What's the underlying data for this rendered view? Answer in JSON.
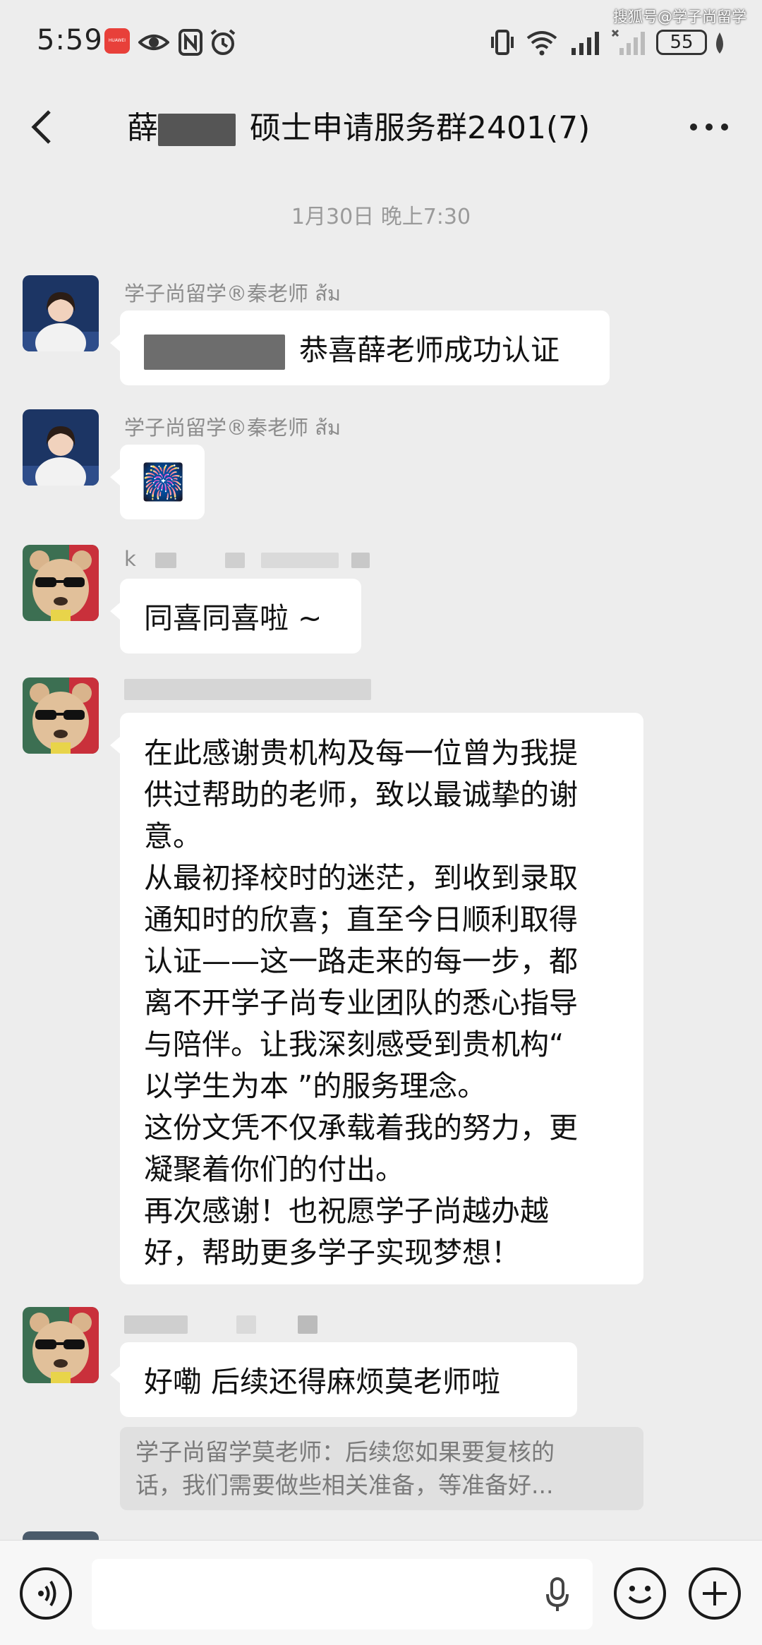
{
  "status_bar": {
    "time": "5:59",
    "brand_tag": "HUAWEI",
    "battery": "55",
    "watermark": "搜狐号@学子尚留学"
  },
  "nav": {
    "title_prefix": "薛",
    "title_suffix": "硕士申请服务群2401(7)"
  },
  "timestamp": "1月30日 晚上7:30",
  "messages": [
    {
      "sender": "学子尚留学®秦老师 ส้ม",
      "text_prefix": "",
      "text": "恭喜薛老师成功认证"
    },
    {
      "sender": "学子尚留学®秦老师 ส้ม",
      "emoji": "🎆"
    },
    {
      "sender": "k",
      "text": "同喜同喜啦 ~"
    },
    {
      "lines": [
        "在此感谢贵机构及每一位曾为我提",
        "供过帮助的老师，致以最诚挚的谢",
        "意。",
        "从最初择校时的迷茫，到收到录取",
        "通知时的欣喜；直至今日顺利取得",
        "认证——这一路走来的每一步，都",
        "离不开学子尚专业团队的悉心指导",
        "与陪伴。让我深刻感受到贵机构“",
        "以学生为本 ”的服务理念。",
        "这份文凭不仅承载着我的努力，更",
        "凝聚着你们的付出。",
        "再次感谢！也祝愿学子尚越办越",
        "好，帮助更多学子实现梦想！"
      ]
    },
    {
      "text": "好嘞  后续还得麻烦莫老师啦",
      "quote_lines": [
        "学子尚留学莫老师：后续您如果要复核的",
        "话，我们需要做些相关准备，等准备好..."
      ]
    }
  ]
}
